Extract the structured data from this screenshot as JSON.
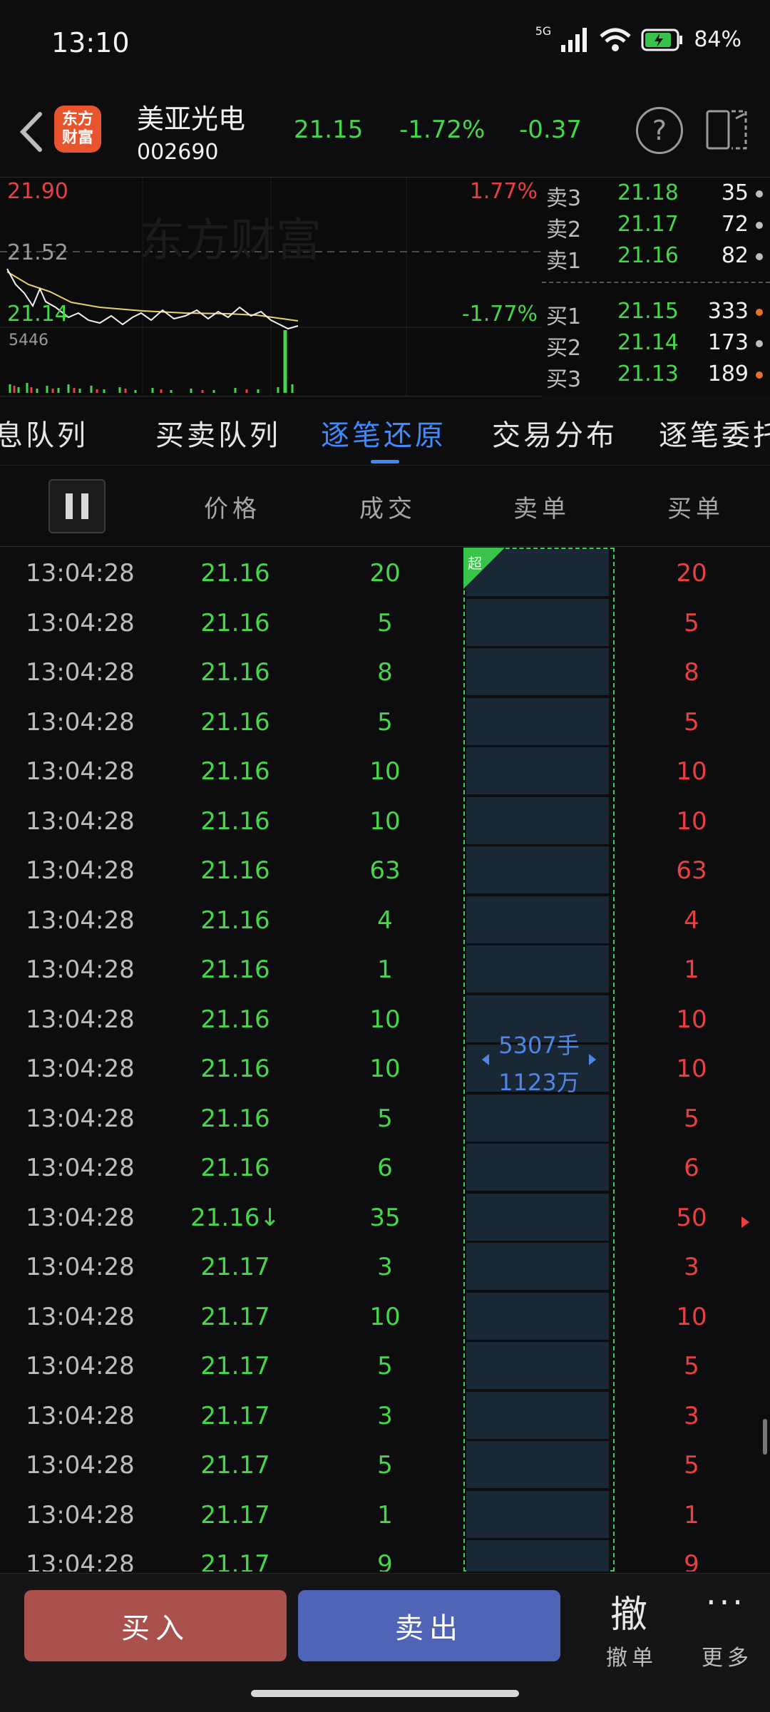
{
  "status_bar": {
    "time": "13:10",
    "network": "5G",
    "battery": "84%"
  },
  "header": {
    "logo_text": "东方财富",
    "stock_name": "美亚光电",
    "stock_code": "002690",
    "price": "21.15",
    "change_pct": "-1.72%",
    "change": "-0.37"
  },
  "chart": {
    "watermark": "东方财富",
    "high_price": "21.90",
    "mid_price": "21.52",
    "low_price": "21.14",
    "high_pct": "1.77%",
    "low_pct": "-1.77%",
    "volume_label": "5446"
  },
  "order_book": {
    "asks": [
      {
        "label": "卖3",
        "price": "21.18",
        "vol": "35"
      },
      {
        "label": "卖2",
        "price": "21.17",
        "vol": "72"
      },
      {
        "label": "卖1",
        "price": "21.16",
        "vol": "82"
      }
    ],
    "bids": [
      {
        "label": "买1",
        "price": "21.15",
        "vol": "333"
      },
      {
        "label": "买2",
        "price": "21.14",
        "vol": "173"
      },
      {
        "label": "买3",
        "price": "21.13",
        "vol": "189"
      }
    ]
  },
  "tabs": [
    "息队列",
    "买卖队列",
    "逐笔还原",
    "交易分布",
    "逐笔委托"
  ],
  "active_tab": "逐笔还原",
  "table_headers": {
    "price": "价格",
    "volume": "成交",
    "sell": "卖单",
    "buy": "买单"
  },
  "sell_summary": {
    "tag": "超",
    "hands": "5307手",
    "amount": "1123万"
  },
  "rows": [
    {
      "time": "13:04:28",
      "price": "21.16",
      "vol": "20",
      "buy": "20"
    },
    {
      "time": "13:04:28",
      "price": "21.16",
      "vol": "5",
      "buy": "5"
    },
    {
      "time": "13:04:28",
      "price": "21.16",
      "vol": "8",
      "buy": "8"
    },
    {
      "time": "13:04:28",
      "price": "21.16",
      "vol": "5",
      "buy": "5"
    },
    {
      "time": "13:04:28",
      "price": "21.16",
      "vol": "10",
      "buy": "10"
    },
    {
      "time": "13:04:28",
      "price": "21.16",
      "vol": "10",
      "buy": "10"
    },
    {
      "time": "13:04:28",
      "price": "21.16",
      "vol": "63",
      "buy": "63"
    },
    {
      "time": "13:04:28",
      "price": "21.16",
      "vol": "4",
      "buy": "4"
    },
    {
      "time": "13:04:28",
      "price": "21.16",
      "vol": "1",
      "buy": "1"
    },
    {
      "time": "13:04:28",
      "price": "21.16",
      "vol": "10",
      "buy": "10"
    },
    {
      "time": "13:04:28",
      "price": "21.16",
      "vol": "10",
      "buy": "10"
    },
    {
      "time": "13:04:28",
      "price": "21.16",
      "vol": "5",
      "buy": "5"
    },
    {
      "time": "13:04:28",
      "price": "21.16",
      "vol": "6",
      "buy": "6"
    },
    {
      "time": "13:04:28",
      "price": "21.16↓",
      "vol": "35",
      "buy": "50"
    },
    {
      "time": "13:04:28",
      "price": "21.17",
      "vol": "3",
      "buy": "3"
    },
    {
      "time": "13:04:28",
      "price": "21.17",
      "vol": "10",
      "buy": "10"
    },
    {
      "time": "13:04:28",
      "price": "21.17",
      "vol": "5",
      "buy": "5"
    },
    {
      "time": "13:04:28",
      "price": "21.17",
      "vol": "3",
      "buy": "3"
    },
    {
      "time": "13:04:28",
      "price": "21.17",
      "vol": "5",
      "buy": "5"
    },
    {
      "time": "13:04:28",
      "price": "21.17",
      "vol": "1",
      "buy": "1"
    },
    {
      "time": "13:04:28",
      "price": "21.17",
      "vol": "9",
      "buy": "9"
    }
  ],
  "bottom_bar": {
    "buy": "买入",
    "sell": "卖出",
    "cancel_glyph": "撤",
    "cancel": "撤单",
    "more_glyph": "···",
    "more": "更多"
  },
  "colors": {
    "up": "#e84040",
    "down": "#46d64a",
    "accent": "#3d8bff",
    "buy_btn": "#a9504d",
    "sell_btn": "#4f64b6"
  }
}
